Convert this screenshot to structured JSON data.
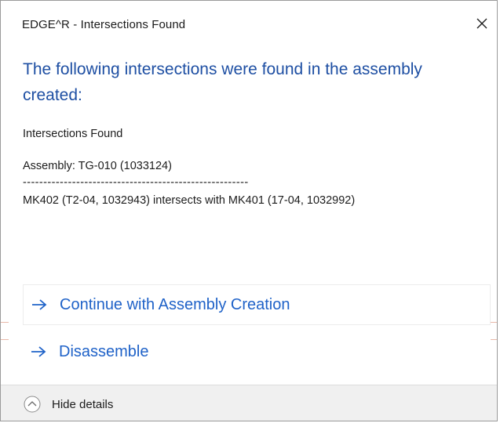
{
  "window": {
    "title": "EDGE^R - Intersections Found"
  },
  "main_instruction": "The following intersections were found in the assembly created:",
  "content": {
    "heading": "Intersections Found",
    "assembly_line": "Assembly: TG-010 (1033124)",
    "separator": "-------------------------------------------------------",
    "intersection_line": "MK402 (T2-04, 1032943) intersects with MK401 (17-04, 1032992)"
  },
  "commands": [
    {
      "label": "Continue with Assembly Creation",
      "icon": "arrow-right-icon"
    },
    {
      "label": "Disassemble",
      "icon": "arrow-right-icon"
    }
  ],
  "footer": {
    "details_label": "Hide details",
    "icon": "chevron-up-icon"
  },
  "colors": {
    "instruction_blue": "#1e4fa3",
    "link_blue": "#1f62c8",
    "footer_bg": "#f0f0f0"
  }
}
